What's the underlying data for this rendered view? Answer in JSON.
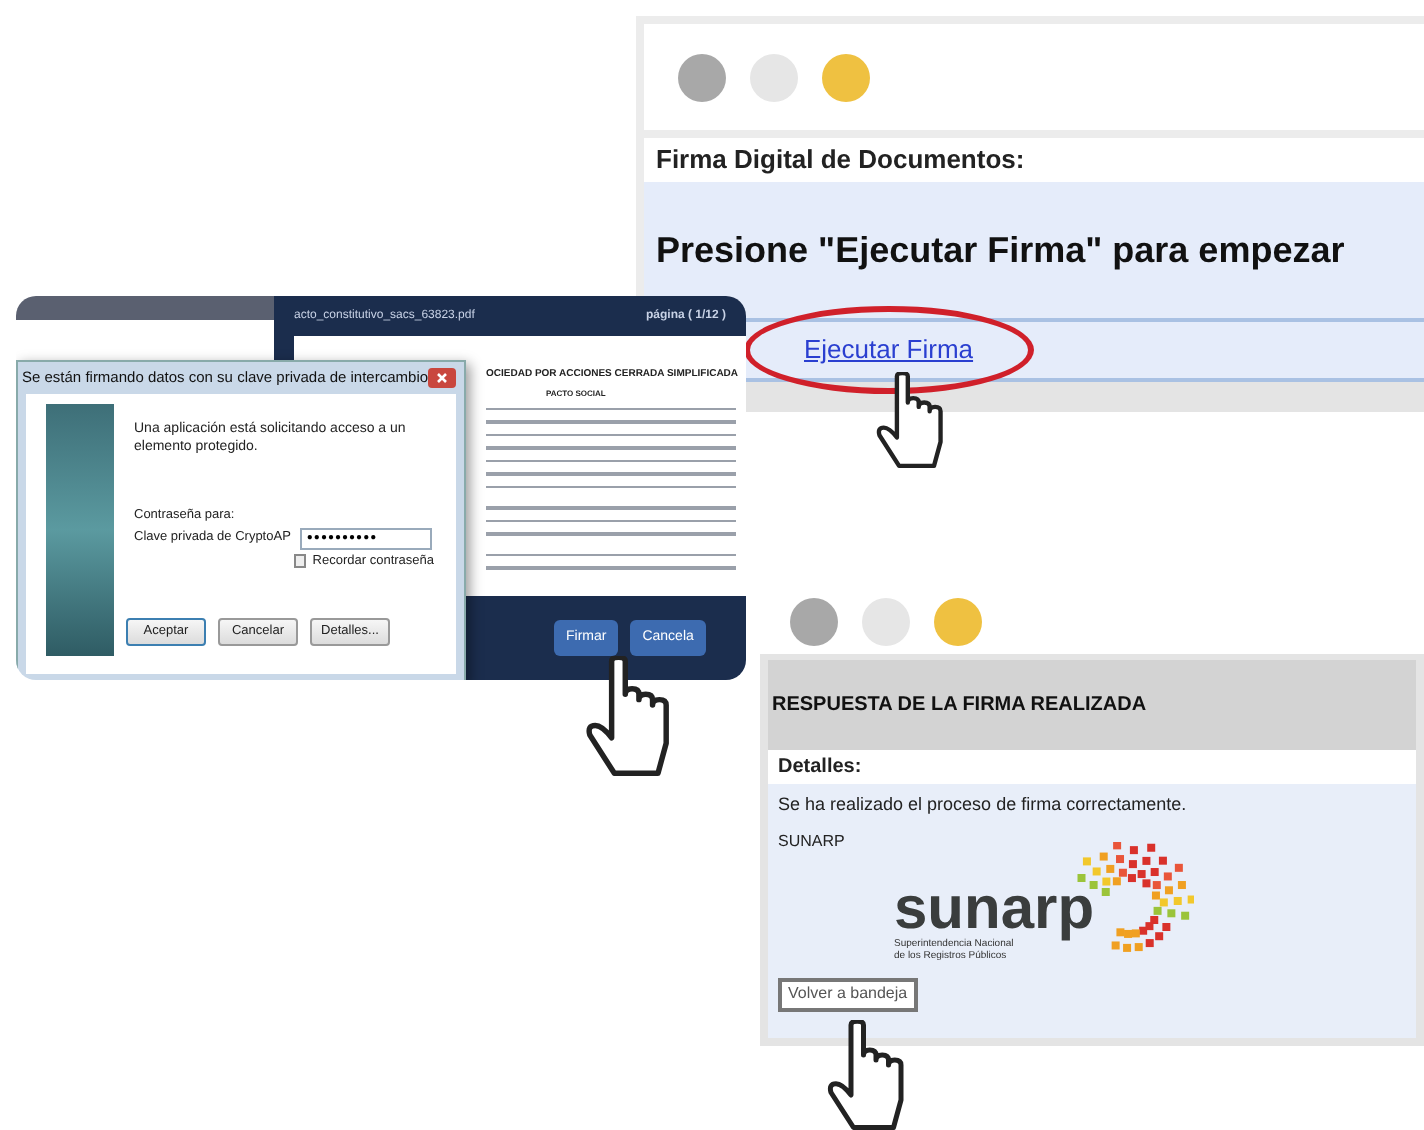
{
  "signing_page": {
    "title": "Firma Digital de Documentos:",
    "instruction": "Presione \"Ejecutar Firma\" para empezar",
    "link": "Ejecutar Firma",
    "link_highlighted": true
  },
  "pdf_viewer": {
    "filename": "acto_constitutivo_sacs_63823.pdf",
    "page": "página ( 1/12 )",
    "doc_heading": "OCIEDAD POR ACCIONES CERRADA SIMPLIFICADA",
    "doc_subheading": "PACTO SOCIAL",
    "buttons": [
      {
        "label": "Firmar",
        "kind": "primary"
      },
      {
        "label": "Cancela",
        "kind": "primary"
      }
    ]
  },
  "dialog": {
    "title": "Se están firmando datos con su clave privada de intercambio",
    "message": "Una aplicación está solicitando acceso a un elemento protegido.",
    "password_label": "Contraseña para:",
    "key_label": "Clave privada de CryptoAP",
    "password_value": "●●●●●●●●●●",
    "remember": {
      "label": "Recordar contraseña",
      "checked": false
    },
    "buttons": [
      {
        "label": "Aceptar",
        "selected": true
      },
      {
        "label": "Cancelar",
        "selected": false
      },
      {
        "label": "Detalles...",
        "selected": false
      }
    ]
  },
  "response_page": {
    "heading": "RESPUESTA DE LA FIRMA REALIZADA",
    "details_label": "Detalles:",
    "message": "Se ha realizado el proceso de firma correctamente.",
    "organization": "SUNARP",
    "logo_name": "sunarp",
    "logo_tagline": [
      "Superintendencia Nacional",
      "de los Registros Públicos"
    ],
    "back_button": "Volver a bandeja"
  }
}
